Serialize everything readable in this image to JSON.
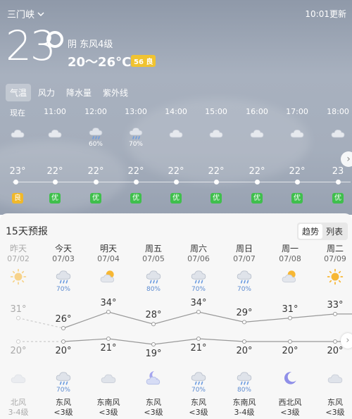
{
  "location": "三门峡",
  "clock": "10:01更新",
  "current": {
    "temp": "23",
    "condition": "阴  东风4级",
    "range": "20～26°C",
    "aqi": "56 良",
    "aqi_color": "#f0c330"
  },
  "tabs": [
    {
      "label": "气温",
      "active": true
    },
    {
      "label": "风力",
      "active": false
    },
    {
      "label": "降水量",
      "active": false
    },
    {
      "label": "紫外线",
      "active": false
    }
  ],
  "hourly": [
    {
      "time": "现在",
      "icon": "cloud-icon",
      "precip": "",
      "temp": "23°",
      "aqi": "良",
      "aqi_color": "#f0b82a"
    },
    {
      "time": "11:00",
      "icon": "cloud-icon",
      "precip": "",
      "temp": "22°",
      "aqi": "优",
      "aqi_color": "#3fbf4c"
    },
    {
      "time": "12:00",
      "icon": "rain-cloud-icon",
      "precip": "60%",
      "temp": "22°",
      "aqi": "优",
      "aqi_color": "#3fbf4c"
    },
    {
      "time": "13:00",
      "icon": "rain-cloud-icon",
      "precip": "70%",
      "temp": "22°",
      "aqi": "优",
      "aqi_color": "#3fbf4c"
    },
    {
      "time": "14:00",
      "icon": "cloud-icon",
      "precip": "",
      "temp": "22°",
      "aqi": "优",
      "aqi_color": "#3fbf4c"
    },
    {
      "time": "15:00",
      "icon": "cloud-icon",
      "precip": "",
      "temp": "22°",
      "aqi": "优",
      "aqi_color": "#3fbf4c"
    },
    {
      "time": "16:00",
      "icon": "cloud-icon",
      "precip": "",
      "temp": "22°",
      "aqi": "优",
      "aqi_color": "#3fbf4c"
    },
    {
      "time": "17:00",
      "icon": "cloud-icon",
      "precip": "",
      "temp": "22°",
      "aqi": "优",
      "aqi_color": "#3fbf4c"
    },
    {
      "time": "18:00",
      "icon": "cloud-icon",
      "precip": "",
      "temp": "23",
      "aqi": "优",
      "aqi_color": "#3fbf4c"
    }
  ],
  "forecast": {
    "title": "15天预报",
    "toggle": [
      "趋势",
      "列表"
    ],
    "days": [
      {
        "name": "昨天",
        "date": "07/02",
        "day_icon": "sun-icon",
        "day_precip": "",
        "high": "31°",
        "low": "20°",
        "night_icon": "cloud-icon",
        "night_precip": "",
        "wind": "北风",
        "level": "3-4级",
        "past": true
      },
      {
        "name": "今天",
        "date": "07/03",
        "day_icon": "rain-cloud-icon",
        "day_precip": "70%",
        "high": "26°",
        "low": "20°",
        "night_icon": "rain-cloud-icon",
        "night_precip": "70%",
        "wind": "东风",
        "level": "<3级",
        "past": false
      },
      {
        "name": "明天",
        "date": "07/04",
        "day_icon": "partly-cloudy-icon",
        "day_precip": "",
        "high": "34°",
        "low": "21°",
        "night_icon": "cloud-icon",
        "night_precip": "",
        "wind": "东南风",
        "level": "<3级",
        "past": false
      },
      {
        "name": "周五",
        "date": "07/05",
        "day_icon": "rain-cloud-icon",
        "day_precip": "80%",
        "high": "28°",
        "low": "19°",
        "night_icon": "moon-cloud-icon",
        "night_precip": "",
        "wind": "东风",
        "level": "<3级",
        "past": false
      },
      {
        "name": "周六",
        "date": "07/06",
        "day_icon": "rain-cloud-icon",
        "day_precip": "70%",
        "high": "34°",
        "low": "21°",
        "night_icon": "rain-cloud-icon",
        "night_precip": "70%",
        "wind": "东风",
        "level": "<3级",
        "past": false
      },
      {
        "name": "周日",
        "date": "07/07",
        "day_icon": "rain-cloud-icon",
        "day_precip": "70%",
        "high": "29°",
        "low": "20°",
        "night_icon": "rain-cloud-icon",
        "night_precip": "80%",
        "wind": "东南风",
        "level": "3-4级",
        "past": false
      },
      {
        "name": "周一",
        "date": "07/08",
        "day_icon": "partly-cloudy-icon",
        "day_precip": "",
        "high": "31°",
        "low": "20°",
        "night_icon": "moon-icon",
        "night_precip": "",
        "wind": "西北风",
        "level": "<3级",
        "past": false
      },
      {
        "name": "周二",
        "date": "07/09",
        "day_icon": "sun-icon",
        "day_precip": "",
        "high": "33°",
        "low": "20°",
        "night_icon": "cloud-icon",
        "night_precip": "",
        "wind": "东风",
        "level": "<3级",
        "past": false
      }
    ]
  }
}
